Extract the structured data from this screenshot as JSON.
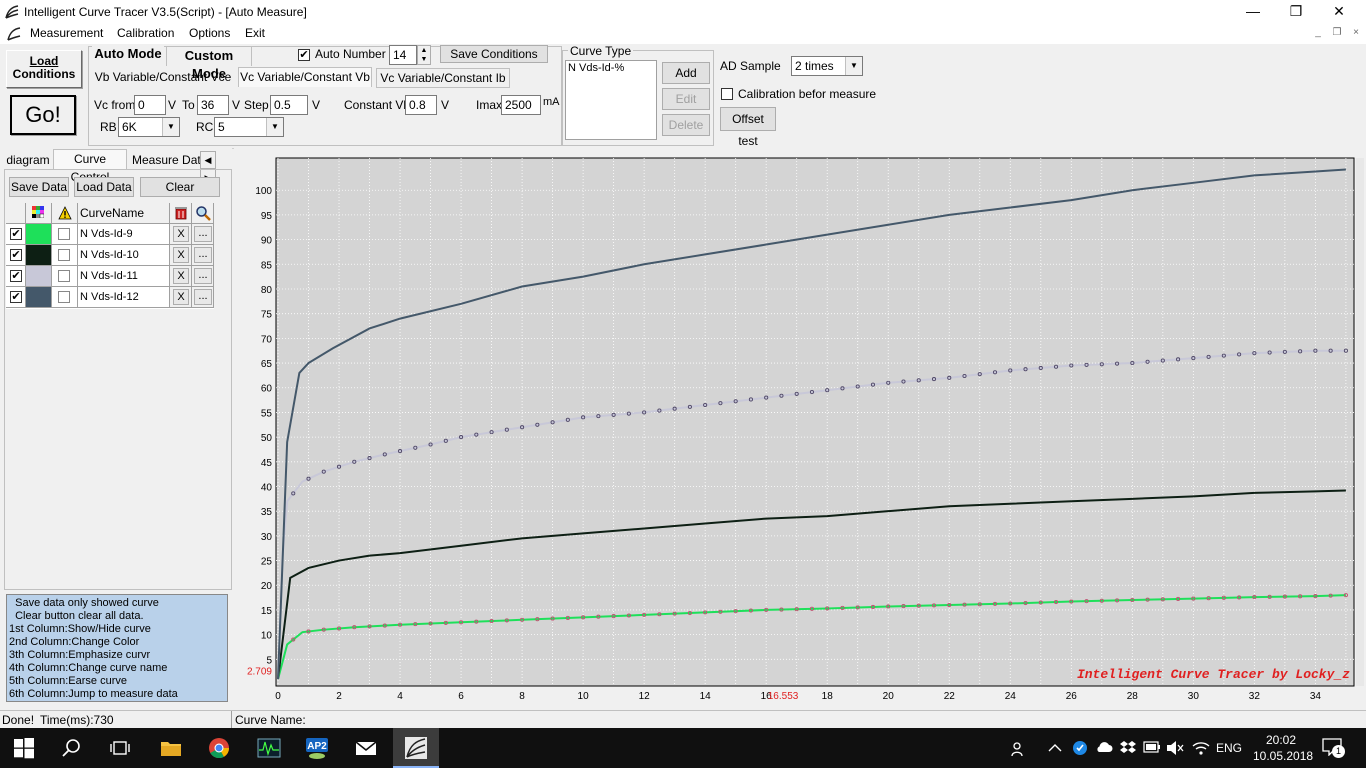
{
  "window": {
    "title": "Intelligent Curve Tracer V3.5(Script) - [Auto Measure]",
    "min_glyph": "—",
    "max_glyph": "❐",
    "close_glyph": "✕"
  },
  "menu": {
    "items": [
      "Measurement",
      "Calibration",
      "Options",
      "Exit"
    ],
    "mdi_min": "_",
    "mdi_restore": "❐",
    "mdi_close": "×"
  },
  "toolbar": {
    "load_conditions_l1": "Load",
    "load_conditions_l2": "Conditions",
    "go_label": "Go!",
    "auto_mode_tab": "Auto Mode",
    "custom_mode_tab": "Custom Mode",
    "auto_number_label": "Auto Number",
    "auto_number_value": "14",
    "auto_number_checked": "✔",
    "save_conditions": "Save Conditions",
    "subtabs": [
      "Vb Variable/Constant Vce",
      "Vc Variable/Constant Vb",
      "Vc Variable/Constant Ib"
    ],
    "vc_from_label": "Vc from",
    "vc_from_value": "0",
    "unit_v": "V",
    "to_label": "To",
    "to_value": "36",
    "step_label": "Step",
    "step_value": "0.5",
    "constant_vb_label": "Constant Vb",
    "constant_vb_value": "0.8",
    "imax_label": "Imax",
    "imax_value": "2500",
    "unit_ma": "mA",
    "rb_label": "RB",
    "rb_value": "6K",
    "rc_label": "RC",
    "rc_value": "5",
    "curve_type_title": "Curve Type",
    "curve_type_item": "N Vds-Id-%",
    "add": "Add",
    "edit": "Edit",
    "delete": "Delete",
    "ad_sample_label": "AD Sample",
    "ad_sample_value": "2 times",
    "calibration_label": "Calibration befor measure",
    "offset_test": "Offset test"
  },
  "left": {
    "tabs": [
      "diagram",
      "Curve Control",
      "Measure Data"
    ],
    "save_data": "Save Data",
    "load_data": "Load Data",
    "clear": "Clear",
    "col_curvename": "CurveName",
    "curves": [
      {
        "name": "N Vds-Id-9",
        "color": "#1ee05a",
        "checked": "✔"
      },
      {
        "name": "N Vds-Id-10",
        "color": "#0d1f14",
        "checked": "✔"
      },
      {
        "name": "N Vds-Id-11",
        "color": "#c8c8d8",
        "checked": "✔"
      },
      {
        "name": "N Vds-Id-12",
        "color": "#44586a",
        "checked": "✔"
      }
    ],
    "x_label": "X",
    "dots_label": "...",
    "info_lines": [
      "  Save data only showed curve",
      "  Clear button clear all data.",
      "1st Column:Show/Hide curve",
      "2nd Column:Change Color",
      "3th Column:Emphasize curvr",
      "4th Column:Change curve name",
      "5th Column:Earse curve",
      "6th Column:Jump to measure data"
    ]
  },
  "chart_data": {
    "type": "line",
    "x_ticks": [
      "0",
      "2",
      "4",
      "6",
      "8",
      "10",
      "12",
      "14",
      "16",
      "18",
      "20",
      "22",
      "24",
      "26",
      "28",
      "30",
      "32",
      "34"
    ],
    "y_ticks": [
      "5",
      "10",
      "15",
      "20",
      "25",
      "30",
      "35",
      "40",
      "45",
      "50",
      "55",
      "60",
      "65",
      "70",
      "75",
      "80",
      "85",
      "90",
      "95",
      "100"
    ],
    "xlim": [
      0,
      35.2
    ],
    "ylim": [
      0,
      104.5
    ],
    "cursor_x_label": "16.553",
    "cursor_y_label": "2.709",
    "watermark": "Intelligent Curve Tracer by Locky_z",
    "series": [
      {
        "color": "#1ee05a",
        "dot": "#c05070",
        "points": [
          [
            0,
            1
          ],
          [
            0.3,
            8
          ],
          [
            0.8,
            10.5
          ],
          [
            1.5,
            11
          ],
          [
            2.5,
            11.5
          ],
          [
            4,
            12
          ],
          [
            6,
            12.5
          ],
          [
            8,
            13
          ],
          [
            10,
            13.5
          ],
          [
            12,
            14
          ],
          [
            14,
            14.5
          ],
          [
            16,
            15
          ],
          [
            18,
            15.3
          ],
          [
            20,
            15.7
          ],
          [
            22,
            16
          ],
          [
            24,
            16.3
          ],
          [
            26,
            16.7
          ],
          [
            28,
            17
          ],
          [
            30,
            17.3
          ],
          [
            32,
            17.6
          ],
          [
            34,
            17.8
          ],
          [
            35,
            18
          ]
        ]
      },
      {
        "color": "#0d1f14",
        "points": [
          [
            0,
            1
          ],
          [
            0.4,
            21.5
          ],
          [
            1,
            23.5
          ],
          [
            2,
            25
          ],
          [
            3,
            26
          ],
          [
            4,
            26.5
          ],
          [
            6,
            28
          ],
          [
            8,
            29.5
          ],
          [
            10,
            30.5
          ],
          [
            12,
            31.5
          ],
          [
            14,
            32.5
          ],
          [
            16,
            33.5
          ],
          [
            18,
            34
          ],
          [
            20,
            35
          ],
          [
            22,
            36
          ],
          [
            24,
            36.5
          ],
          [
            26,
            37
          ],
          [
            28,
            37.5
          ],
          [
            30,
            38
          ],
          [
            32,
            38.7
          ],
          [
            34,
            39
          ],
          [
            35,
            39.2
          ]
        ]
      },
      {
        "color": "#c8c8d8",
        "dot": "#504868",
        "points": [
          [
            0,
            1
          ],
          [
            0.15,
            26
          ],
          [
            0.3,
            37
          ],
          [
            0.8,
            41
          ],
          [
            1.5,
            43
          ],
          [
            2.5,
            45
          ],
          [
            3.5,
            46.5
          ],
          [
            5,
            48.5
          ],
          [
            6,
            50
          ],
          [
            8,
            52
          ],
          [
            10,
            54
          ],
          [
            12,
            55
          ],
          [
            14,
            56.5
          ],
          [
            16,
            58
          ],
          [
            18,
            59.5
          ],
          [
            20,
            61
          ],
          [
            22,
            62
          ],
          [
            24,
            63.5
          ],
          [
            26,
            64.5
          ],
          [
            28,
            65
          ],
          [
            30,
            66
          ],
          [
            32,
            67
          ],
          [
            34,
            67.5
          ],
          [
            35,
            67.5
          ]
        ]
      },
      {
        "color": "#44586a",
        "points": [
          [
            0,
            1
          ],
          [
            0.3,
            49
          ],
          [
            0.7,
            63
          ],
          [
            1,
            65
          ],
          [
            1.8,
            68
          ],
          [
            3,
            72
          ],
          [
            4,
            74
          ],
          [
            6,
            77
          ],
          [
            8,
            80.5
          ],
          [
            10,
            82.5
          ],
          [
            12,
            85
          ],
          [
            14,
            87
          ],
          [
            16,
            89
          ],
          [
            18,
            91
          ],
          [
            20,
            93
          ],
          [
            22,
            95
          ],
          [
            24,
            96.5
          ],
          [
            26,
            98
          ],
          [
            28,
            100
          ],
          [
            30,
            101.5
          ],
          [
            32,
            103
          ],
          [
            34,
            103.8
          ],
          [
            35,
            104.2
          ]
        ]
      }
    ]
  },
  "status": {
    "done": "Done!",
    "time": "Time(ms):730",
    "curve_name_label": "Curve Name:"
  },
  "taskbar": {
    "language": "ENG",
    "time": "20:02",
    "date": "10.05.2018",
    "notif_count": "1"
  }
}
